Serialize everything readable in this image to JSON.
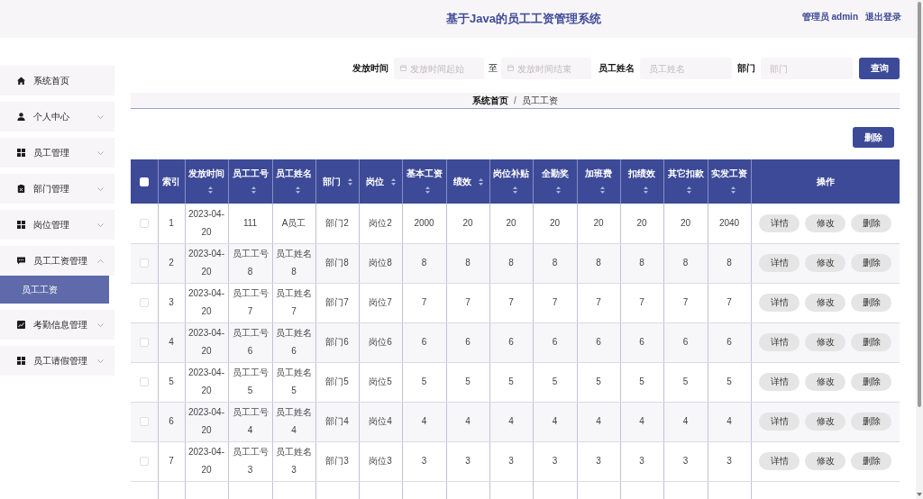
{
  "header": {
    "title": "基于Java的员工工资管理系统",
    "user": "管理员 admin",
    "logout": "退出登录"
  },
  "sidebar": {
    "items": [
      {
        "label": "系统首页",
        "kind": "link"
      },
      {
        "label": "个人中心",
        "kind": "menu",
        "expanded": false
      },
      {
        "label": "员工管理",
        "kind": "menu",
        "expanded": false
      },
      {
        "label": "部门管理",
        "kind": "menu",
        "expanded": false
      },
      {
        "label": "岗位管理",
        "kind": "menu",
        "expanded": false
      },
      {
        "label": "员工工资管理",
        "kind": "menu",
        "expanded": true,
        "children": [
          {
            "label": "员工工资",
            "selected": true
          }
        ]
      },
      {
        "label": "考勤信息管理",
        "kind": "menu",
        "expanded": false
      },
      {
        "label": "员工请假管理",
        "kind": "menu",
        "expanded": false
      }
    ]
  },
  "search": {
    "date_label": "发放时间",
    "date_start": {
      "placeholder": "发放时间起始"
    },
    "separator": "至",
    "date_end": {
      "placeholder": "发放时间结束"
    },
    "name_label": "员工姓名",
    "name_field": {
      "placeholder": "员工姓名"
    },
    "dept_label": "部门",
    "dept_field": {
      "placeholder": "部门"
    },
    "button": "查询"
  },
  "breadcrumb": {
    "items": [
      {
        "label": "系统首页"
      },
      {
        "label": "员工工资"
      }
    ],
    "separator": "/"
  },
  "toolbar": {
    "delete_button": "删除"
  },
  "table": {
    "select_all": {
      "checked": false
    },
    "columns": [
      {
        "label": "索引",
        "sortable": false
      },
      {
        "label": "发放时间",
        "sortable": true
      },
      {
        "label": "员工工号",
        "sortable": true
      },
      {
        "label": "员工姓名",
        "sortable": true
      },
      {
        "label": "部门",
        "sortable": true
      },
      {
        "label": "岗位",
        "sortable": true
      },
      {
        "label": "基本工资",
        "sortable": true
      },
      {
        "label": "绩效",
        "sortable": true
      },
      {
        "label": "岗位补贴",
        "sortable": true
      },
      {
        "label": "全勤奖",
        "sortable": true
      },
      {
        "label": "加班费",
        "sortable": true
      },
      {
        "label": "扣绩效",
        "sortable": true
      },
      {
        "label": "其它扣款",
        "sortable": true
      },
      {
        "label": "实发工资",
        "sortable": true
      },
      {
        "label": "操作",
        "sortable": false
      }
    ],
    "rows": [
      {
        "checked": false,
        "cells": [
          "1",
          "2023-04-20",
          "111",
          "A员工",
          "部门2",
          "岗位2",
          "2000",
          "20",
          "20",
          "20",
          "20",
          "20",
          "20",
          "2040"
        ],
        "actions": [
          "详情",
          "修改",
          "删除"
        ]
      },
      {
        "checked": false,
        "cells": [
          "2",
          "2023-04-20",
          "员工工号8",
          "员工姓名8",
          "部门8",
          "岗位8",
          "8",
          "8",
          "8",
          "8",
          "8",
          "8",
          "8",
          "8"
        ],
        "actions": [
          "详情",
          "修改",
          "删除"
        ]
      },
      {
        "checked": false,
        "cells": [
          "3",
          "2023-04-20",
          "员工工号7",
          "员工姓名7",
          "部门7",
          "岗位7",
          "7",
          "7",
          "7",
          "7",
          "7",
          "7",
          "7",
          "7"
        ],
        "actions": [
          "详情",
          "修改",
          "删除"
        ]
      },
      {
        "checked": false,
        "cells": [
          "4",
          "2023-04-20",
          "员工工号6",
          "员工姓名6",
          "部门6",
          "岗位6",
          "6",
          "6",
          "6",
          "6",
          "6",
          "6",
          "6",
          "6"
        ],
        "actions": [
          "详情",
          "修改",
          "删除"
        ]
      },
      {
        "checked": false,
        "cells": [
          "5",
          "2023-04-20",
          "员工工号5",
          "员工姓名5",
          "部门5",
          "岗位5",
          "5",
          "5",
          "5",
          "5",
          "5",
          "5",
          "5",
          "5"
        ],
        "actions": [
          "详情",
          "修改",
          "删除"
        ]
      },
      {
        "checked": false,
        "cells": [
          "6",
          "2023-04-20",
          "员工工号4",
          "员工姓名4",
          "部门4",
          "岗位4",
          "4",
          "4",
          "4",
          "4",
          "4",
          "4",
          "4",
          "4"
        ],
        "actions": [
          "详情",
          "修改",
          "删除"
        ]
      },
      {
        "checked": false,
        "cells": [
          "7",
          "2023-04-20",
          "员工工号3",
          "员工姓名3",
          "部门3",
          "岗位3",
          "3",
          "3",
          "3",
          "3",
          "3",
          "3",
          "3",
          "3"
        ],
        "actions": [
          "详情",
          "修改",
          "删除"
        ]
      }
    ]
  }
}
